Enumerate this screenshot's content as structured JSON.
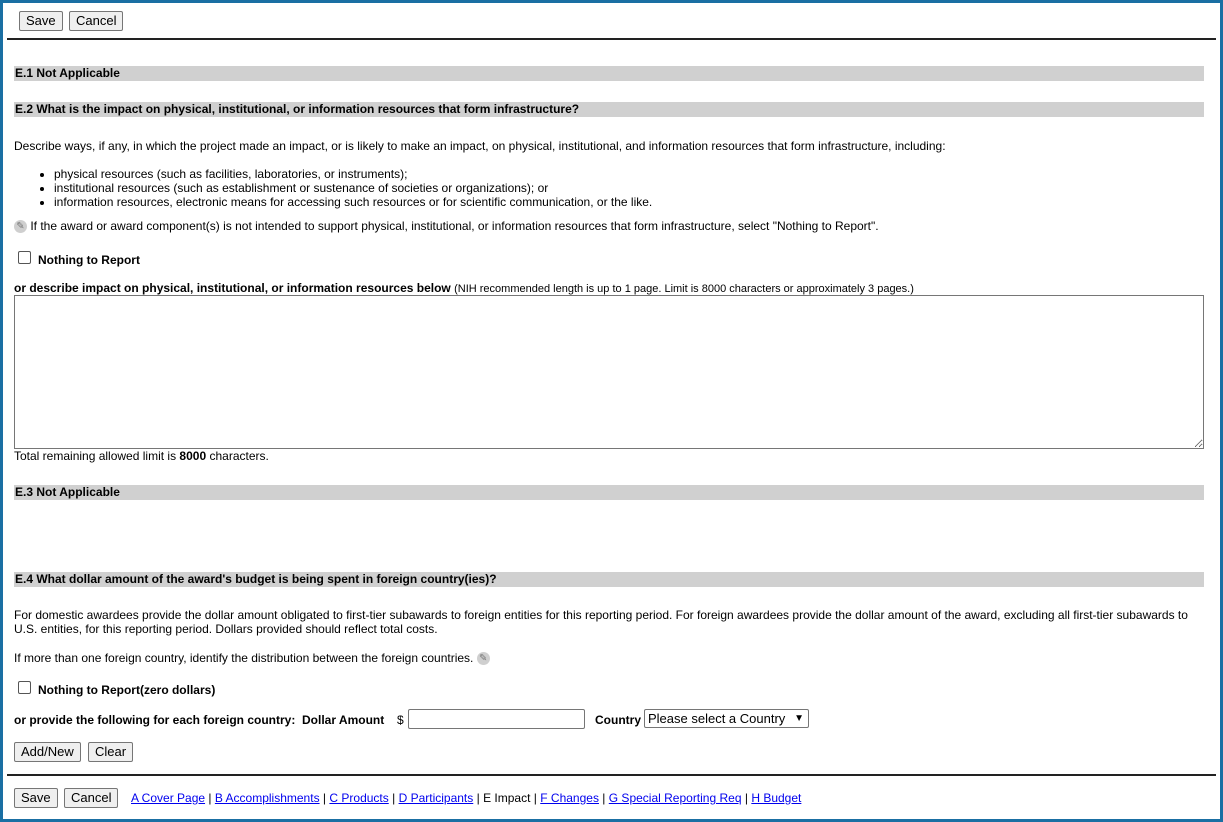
{
  "toolbar_top": {
    "save_label": "Save",
    "cancel_label": "Cancel"
  },
  "e1": {
    "heading": "E.1 Not Applicable"
  },
  "e2": {
    "heading": "E.2 What is the impact on physical, institutional, or information resources that form infrastructure?",
    "description": "Describe ways, if any, in which the project made an impact, or is likely to make an impact, on physical, institutional, and information resources that form infrastructure, including:",
    "bullets": [
      "physical resources (such as facilities, laboratories, or instruments);",
      "institutional resources (such as establishment or sustenance of societies or organizations); or",
      "information resources, electronic means for accessing such resources or for scientific communication, or the like."
    ],
    "hint_icon": "hint-icon",
    "hint": "If the award or award component(s) is not intended to support physical, institutional, or information resources that form infrastructure, select \"Nothing to Report\".",
    "nothing_to_report_label": "Nothing to Report",
    "nothing_to_report_checked": false,
    "describe_label": "or describe impact on physical, institutional, or information resources below",
    "describe_note": "(NIH recommended length is up to 1 page. Limit is 8000 characters or approximately 3 pages.)",
    "textarea_value": "",
    "remaining_prefix": "Total remaining allowed limit is",
    "remaining_count": "8000",
    "remaining_suffix": "characters."
  },
  "e3": {
    "heading": "E.3 Not Applicable"
  },
  "e4": {
    "heading": "E.4 What dollar amount of the award's budget is being spent in foreign country(ies)?",
    "description_line1": "For domestic awardees provide the dollar amount obligated to first-tier subawards to foreign entities for this reporting period. For foreign awardees provide the dollar amount of the award, excluding all first-tier subawards to",
    "description_line2": "U.S. entities, for this reporting period. Dollars provided should reflect total costs.",
    "multi_country": "If more than one foreign country, identify the distribution between the foreign countries.",
    "hint_icon": "hint-icon",
    "nothing_to_report_label": "Nothing to Report(zero dollars)",
    "nothing_to_report_checked": false,
    "provide_label": "or provide the following for each foreign country:",
    "dollar_amount_label": "Dollar Amount",
    "currency_symbol": "$",
    "amount_value": "",
    "country_label": "Country",
    "country_selected": "Please select a Country",
    "add_new_label": "Add/New",
    "clear_label": "Clear"
  },
  "toolbar_bottom": {
    "save_label": "Save",
    "cancel_label": "Cancel"
  },
  "nav": {
    "separator": "|",
    "items": [
      {
        "label": "A Cover Page",
        "current": false
      },
      {
        "label": "B Accomplishments",
        "current": false
      },
      {
        "label": "C Products",
        "current": false
      },
      {
        "label": "D Participants",
        "current": false
      },
      {
        "label": "E Impact",
        "current": true
      },
      {
        "label": "F Changes",
        "current": false
      },
      {
        "label": "G Special Reporting Req",
        "current": false
      },
      {
        "label": "H Budget",
        "current": false
      }
    ]
  },
  "colors": {
    "frame_border": "#1a6fa3",
    "section_band": "#d0d0d0",
    "link": "#0000ee"
  }
}
